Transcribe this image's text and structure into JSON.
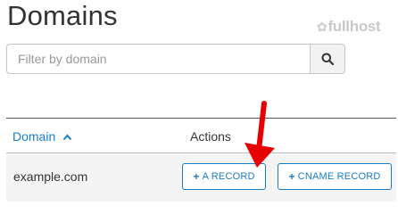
{
  "page": {
    "title": "Domains"
  },
  "brand": {
    "logo_text": "fullhost"
  },
  "search": {
    "placeholder": "Filter by domain",
    "value": "",
    "icon": "search-icon"
  },
  "table": {
    "columns": [
      {
        "label": "Domain",
        "sort": "ascending"
      },
      {
        "label": "Actions"
      }
    ],
    "rows": [
      {
        "domain": "example.com",
        "actions": [
          {
            "label": "A RECORD",
            "icon": "plus-icon"
          },
          {
            "label": "CNAME RECORD",
            "icon": "plus-icon"
          }
        ]
      }
    ]
  },
  "colors": {
    "accent": "#1a7dc4",
    "annotation_arrow": "#e60000",
    "row_background": "#f4f4f4"
  },
  "annotation": {
    "type": "arrow",
    "points_to": "A RECORD button"
  }
}
